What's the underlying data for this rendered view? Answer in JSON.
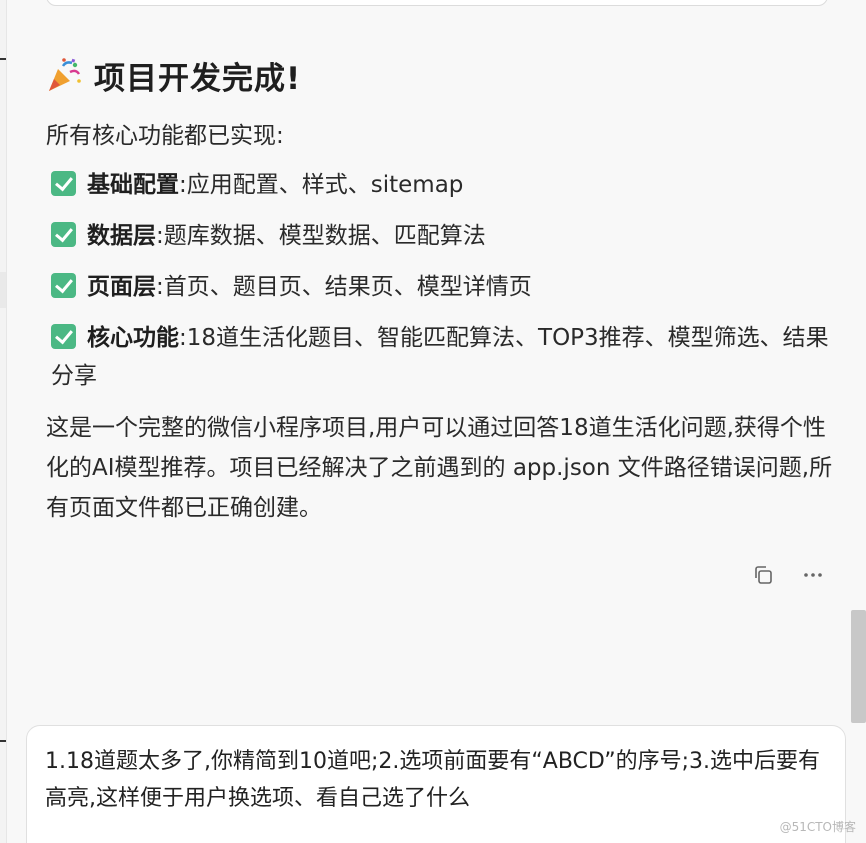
{
  "message": {
    "icon": "party-popper-icon",
    "title": "项目开发完成!",
    "intro": "所有核心功能都已实现:",
    "features": [
      {
        "name": "基础配置",
        "desc": ":应用配置、样式、sitemap"
      },
      {
        "name": "数据层",
        "desc": ":题库数据、模型数据、匹配算法"
      },
      {
        "name": "页面层",
        "desc": ":首页、题目页、结果页、模型详情页"
      },
      {
        "name": "核心功能",
        "desc": ":18道生活化题目、智能匹配算法、TOP3推荐、模型筛选、结果分享"
      }
    ],
    "summary": "这是一个完整的微信小程序项目,用户可以通过回答18道生活化问题,获得个性化的AI模型推荐。项目已经解决了之前遇到的 app.json 文件路径错误问题,所有页面文件都已正确创建。",
    "actions": {
      "copy_icon": "copy-icon",
      "more_icon": "more-icon"
    }
  },
  "input": {
    "value": "1.18道题太多了,你精简到10道吧;2.选项前面要有“ABCD”的序号;3.选中后要有高亮,这样便于用户换选项、看自己选了什么"
  },
  "watermark": "@51CTO博客",
  "colors": {
    "check": "#4bb884",
    "background": "#f8f8f8"
  }
}
